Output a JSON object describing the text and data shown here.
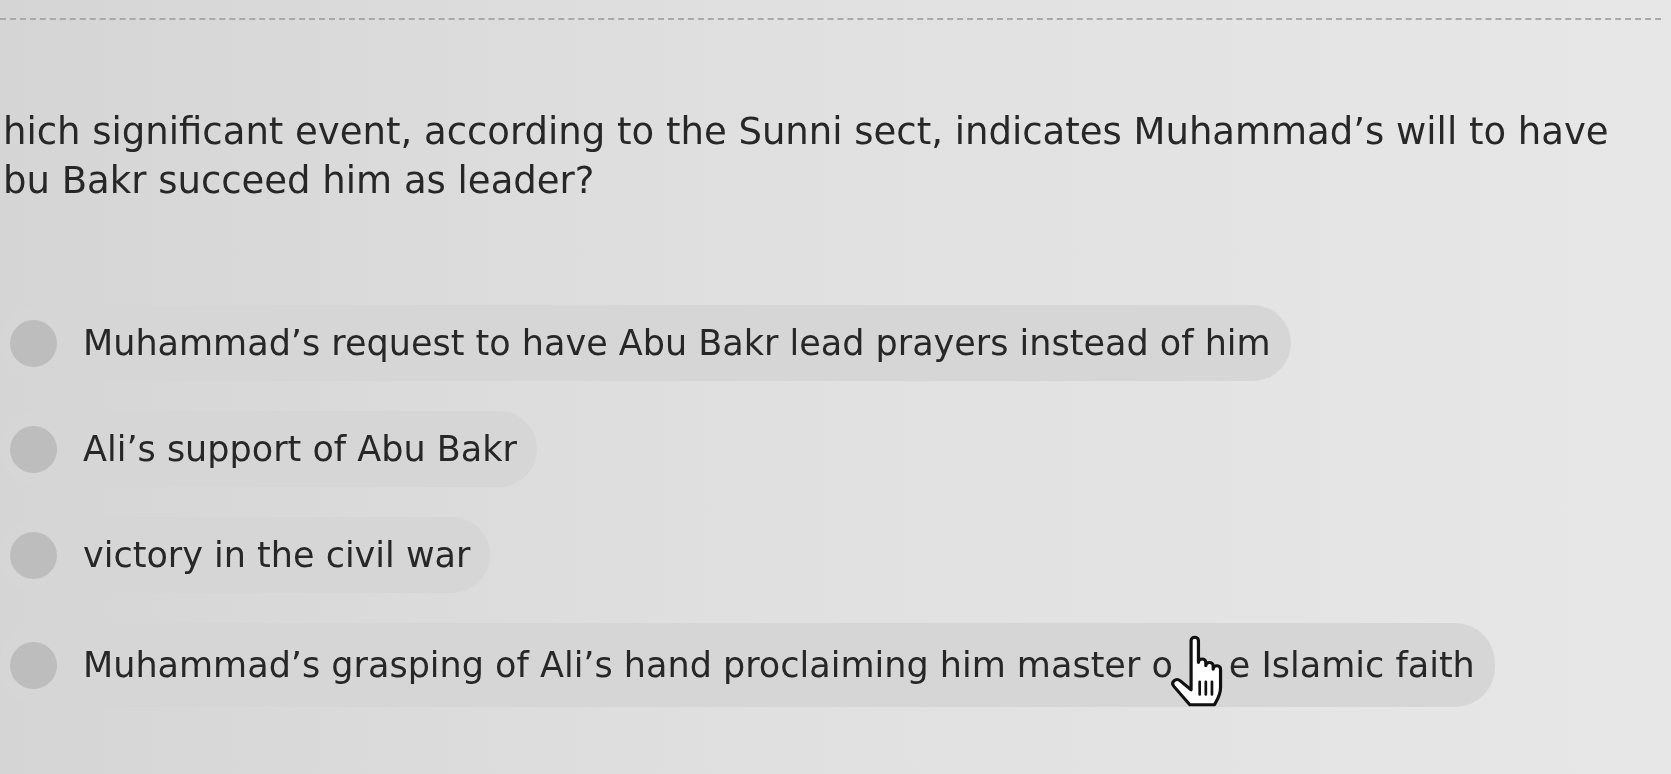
{
  "question": {
    "lines": [
      "hich significant event, according to the Sunni sect, indicates Muhammad’s will to have",
      "bu Bakr succeed him as leader?"
    ]
  },
  "options": [
    {
      "label": "Muhammad’s request to have Abu Bakr lead prayers instead of him",
      "selected": false,
      "hovered": false
    },
    {
      "label": "Ali’s support of Abu Bakr",
      "selected": false,
      "hovered": false
    },
    {
      "label": "victory in the civil war",
      "selected": false,
      "hovered": false
    },
    {
      "label": "Muhammad’s grasping of Ali’s hand proclaiming him master o",
      "label_after_cursor": "e Islamic faith",
      "selected": false,
      "hovered": true
    }
  ]
}
